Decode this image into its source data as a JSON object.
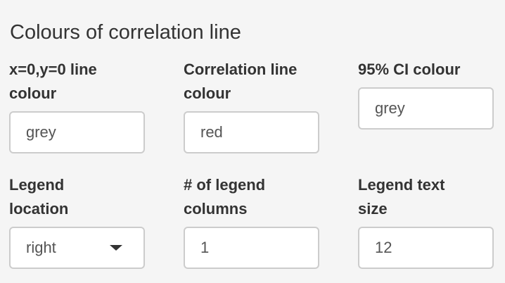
{
  "section": {
    "title": "Colours of correlation line"
  },
  "fields": {
    "zero_line_colour": {
      "label_line1": "x=0,y=0 line",
      "label_line2": "colour",
      "value": "grey"
    },
    "correlation_line_colour": {
      "label_line1": "Correlation line",
      "label_line2": "colour",
      "value": "red"
    },
    "ci_colour": {
      "label_line1": "95% CI colour",
      "value": "grey"
    },
    "legend_location": {
      "label_line1": "Legend",
      "label_line2": "location",
      "selected": "right",
      "icon": "caret-down-icon"
    },
    "legend_columns": {
      "label_line1": "# of legend",
      "label_line2": "columns",
      "value": "1"
    },
    "legend_text_size": {
      "label_line1": "Legend text",
      "label_line2": "size",
      "value": "12"
    }
  }
}
